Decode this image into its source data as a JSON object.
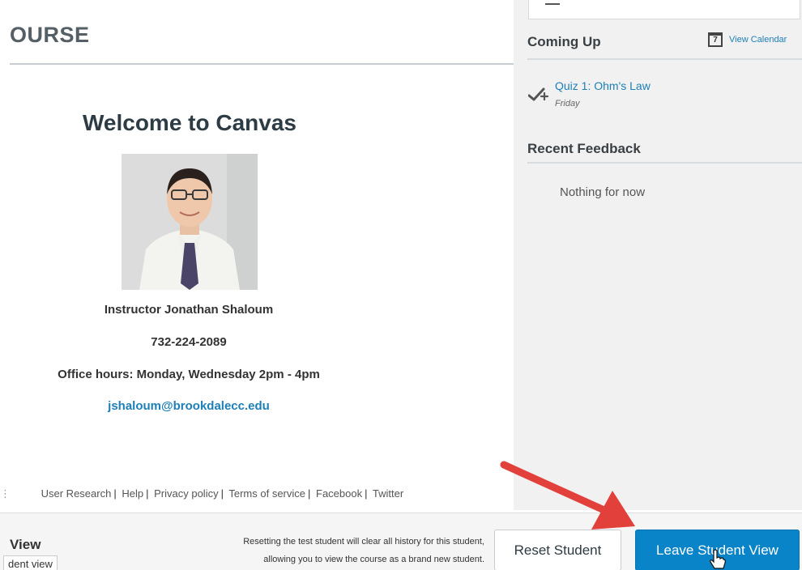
{
  "course": {
    "title": "OURSE"
  },
  "welcome": {
    "heading": "Welcome to Canvas",
    "instructor": "Instructor Jonathan Shaloum",
    "phone": "732-224-2089",
    "office_hours": "Office hours: Monday, Wednesday 2pm - 4pm",
    "email": "jshaloum@brookdalecc.edu"
  },
  "sidebar": {
    "coming_up_heading": "Coming Up",
    "calendar_link": "View Calendar",
    "calendar_day": "7",
    "todo": {
      "title": "Quiz 1: Ohm's Law",
      "due": "Friday"
    },
    "recent_feedback_heading": "Recent Feedback",
    "recent_feedback_empty": "Nothing for now"
  },
  "footer": {
    "links": [
      "User Research",
      "Help",
      "Privacy policy",
      "Terms of service",
      "Facebook",
      "Twitter"
    ]
  },
  "student_view": {
    "title": "View",
    "sub_label": "dent view",
    "description_line1": "Resetting the test student will clear all history for this student,",
    "description_line2": "allowing you to view the course as a brand new student.",
    "reset_button": "Reset Student",
    "leave_button": "Leave Student View"
  },
  "colors": {
    "link": "#1d7fb8",
    "primary_button": "#0a84c9",
    "annotation_arrow": "#e2403a",
    "sidebar_bg": "#f1f1f1"
  },
  "icons": {
    "calendar": "calendar-icon",
    "todo": "quiz-checkmark-icon",
    "pointer": "hand-pointer-icon",
    "annotation": "red-arrow-annotation"
  }
}
